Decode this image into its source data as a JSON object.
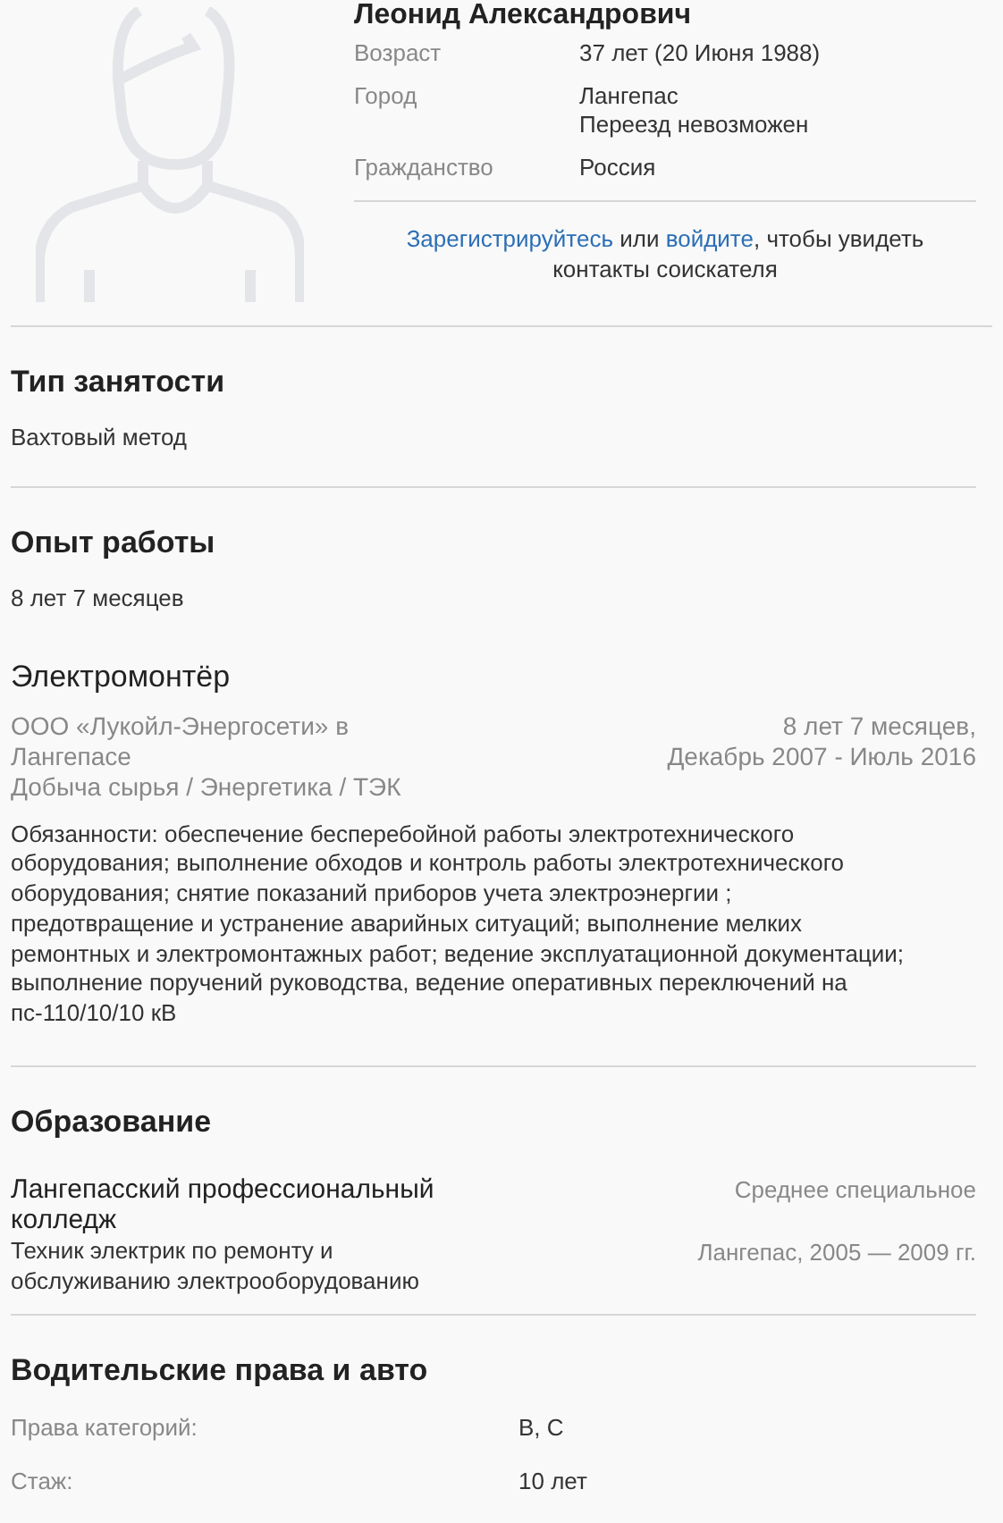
{
  "profile": {
    "name": "Леонид Александрович",
    "fields": [
      {
        "label": "Возраст",
        "values": [
          "37 лет (20 Июня 1988)"
        ]
      },
      {
        "label": "Город",
        "values": [
          "Лангепас",
          "Переезд невозможен"
        ]
      },
      {
        "label": "Гражданство",
        "values": [
          "Россия"
        ]
      }
    ],
    "contacts_notice": {
      "register_link": "Зарегистрируйтесь",
      "or": "или",
      "login_link": "войдите",
      "rest": ", чтобы увидеть контакты соискателя"
    }
  },
  "employment": {
    "title": "Тип занятости",
    "value": "Вахтовый метод"
  },
  "experience": {
    "title": "Опыт работы",
    "total": "8 лет 7 месяцев",
    "jobs": [
      {
        "position": "Электромонтёр",
        "company": "ООО «Лукойл-Энергосети» в Лангепасе",
        "industry": "Добыча сырья / Энергетика / ТЭК",
        "duration": "8 лет 7 месяцев,",
        "period": "Декабрь 2007 - Июль 2016",
        "description": "Обязанности: обеспечение бесперебойной работы электротехнического оборудования; выполнение обходов и контроль работы электротехнического оборудования; снятие показаний приборов учета электроэнергии ; предотвращение и устранение аварийных ситуаций; выполнение мелких ремонтных и электромонтажных работ; ведение эксплуатационной документации; выполнение поручений руководства, ведение оперативных переключений на пс-110/10/10 кВ"
      }
    ]
  },
  "education": {
    "title": "Образование",
    "items": [
      {
        "institution": "Лангепасский профессиональный колледж",
        "specialty": "Техник электрик по ремонту и обслуживанию электрооборудованию",
        "level": "Среднее специальное",
        "place_years": "Лангепас, 2005 — 2009 гг."
      }
    ]
  },
  "driving": {
    "title": "Водительские права и авто",
    "rows": [
      {
        "label": "Права категорий:",
        "value": "B, C"
      },
      {
        "label": "Стаж:",
        "value": "10 лет"
      }
    ]
  }
}
